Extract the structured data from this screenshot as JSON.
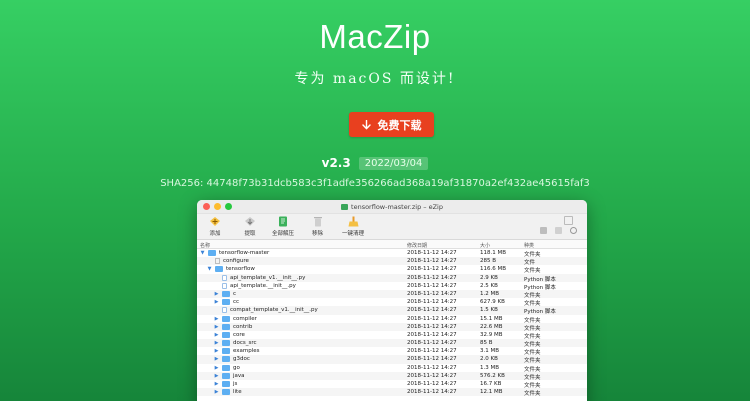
{
  "hero": {
    "title": "MacZip",
    "subtitle": "专为 macOS 而设计!",
    "download_label": "免费下载",
    "version": "v2.3",
    "release_date": "2022/03/04",
    "sha": "SHA256: 44748f73b31dcb583c3f1adfe356266ad368a19af31870a2ef432ae45615faf3"
  },
  "window": {
    "title": "tensorflow-master.zip – eZip",
    "toolbar": {
      "add": "添加",
      "extract": "提取",
      "extract_all": "全部解压",
      "delete": "移除",
      "clean": "一键清理"
    },
    "columns": {
      "name": "名称",
      "date": "修改日期",
      "size": "大小",
      "kind": "种类"
    },
    "rows": [
      {
        "name": "tensorflow-master",
        "depth": 0,
        "type": "folder",
        "expand": "open",
        "date": "2018-11-12 14:27",
        "size": "118.1 MB",
        "kind": "文件夹"
      },
      {
        "name": "configure",
        "depth": 1,
        "type": "file",
        "expand": "",
        "date": "2018-11-12 14:27",
        "size": "285 B",
        "kind": "文件"
      },
      {
        "name": "tensorflow",
        "depth": 1,
        "type": "folder",
        "expand": "open",
        "date": "2018-11-12 14:27",
        "size": "116.6 MB",
        "kind": "文件夹"
      },
      {
        "name": "api_template_v1.__init__.py",
        "depth": 2,
        "type": "py",
        "expand": "",
        "date": "2018-11-12 14:27",
        "size": "2.9 KB",
        "kind": "Python 脚本"
      },
      {
        "name": "api_template.__init__.py",
        "depth": 2,
        "type": "py",
        "expand": "",
        "date": "2018-11-12 14:27",
        "size": "2.5 KB",
        "kind": "Python 脚本"
      },
      {
        "name": "c",
        "depth": 2,
        "type": "folder",
        "expand": "closed",
        "date": "2018-11-12 14:27",
        "size": "1.2 MB",
        "kind": "文件夹"
      },
      {
        "name": "cc",
        "depth": 2,
        "type": "folder",
        "expand": "closed",
        "date": "2018-11-12 14:27",
        "size": "627.9 KB",
        "kind": "文件夹"
      },
      {
        "name": "compat_template_v1.__init__.py",
        "depth": 2,
        "type": "py",
        "expand": "",
        "date": "2018-11-12 14:27",
        "size": "1.5 KB",
        "kind": "Python 脚本"
      },
      {
        "name": "compiler",
        "depth": 2,
        "type": "folder",
        "expand": "closed",
        "date": "2018-11-12 14:27",
        "size": "15.1 MB",
        "kind": "文件夹"
      },
      {
        "name": "contrib",
        "depth": 2,
        "type": "folder",
        "expand": "closed",
        "date": "2018-11-12 14:27",
        "size": "22.6 MB",
        "kind": "文件夹"
      },
      {
        "name": "core",
        "depth": 2,
        "type": "folder",
        "expand": "closed",
        "date": "2018-11-12 14:27",
        "size": "32.9 MB",
        "kind": "文件夹"
      },
      {
        "name": "docs_src",
        "depth": 2,
        "type": "folder",
        "expand": "closed",
        "date": "2018-11-12 14:27",
        "size": "85 B",
        "kind": "文件夹"
      },
      {
        "name": "examples",
        "depth": 2,
        "type": "folder",
        "expand": "closed",
        "date": "2018-11-12 14:27",
        "size": "3.1 MB",
        "kind": "文件夹"
      },
      {
        "name": "g3doc",
        "depth": 2,
        "type": "folder",
        "expand": "closed",
        "date": "2018-11-12 14:27",
        "size": "2.0 KB",
        "kind": "文件夹"
      },
      {
        "name": "go",
        "depth": 2,
        "type": "folder",
        "expand": "closed",
        "date": "2018-11-12 14:27",
        "size": "1.3 MB",
        "kind": "文件夹"
      },
      {
        "name": "java",
        "depth": 2,
        "type": "folder",
        "expand": "closed",
        "date": "2018-11-12 14:27",
        "size": "576.2 KB",
        "kind": "文件夹"
      },
      {
        "name": "js",
        "depth": 2,
        "type": "folder",
        "expand": "closed",
        "date": "2018-11-12 14:27",
        "size": "16.7 KB",
        "kind": "文件夹"
      },
      {
        "name": "lite",
        "depth": 2,
        "type": "folder",
        "expand": "closed",
        "date": "2018-11-12 14:27",
        "size": "12.1 MB",
        "kind": "文件夹"
      }
    ]
  },
  "colors": {
    "accent_button": "#e8401f",
    "folder": "#5eaff2"
  }
}
